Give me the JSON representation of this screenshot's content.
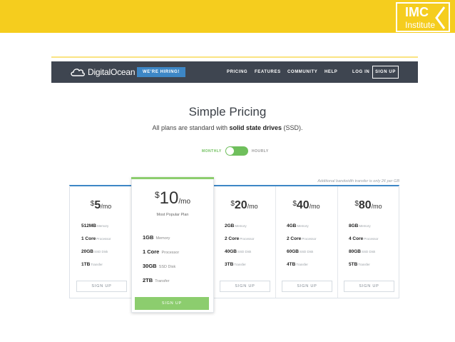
{
  "header_band": {
    "logo_main": "IMC",
    "logo_sub": "Institute",
    "color": "#f5cd1e"
  },
  "navbar": {
    "brand": "DigitalOcean",
    "hiring_badge": "WE'RE HIRING!",
    "items": [
      "PRICING",
      "FEATURES",
      "COMMUNITY",
      "HELP",
      "LOG IN"
    ],
    "signup": "SIGN UP"
  },
  "hero": {
    "title": "Simple Pricing",
    "subtitle_pre": "All plans are standard with ",
    "subtitle_bold": "solid state drives",
    "subtitle_post": " (SSD)."
  },
  "billing_toggle": {
    "monthly": "MONTHLY",
    "hourly": "HOURLY",
    "selected": "MONTHLY"
  },
  "note": "Additional bandwidth transfer is only 2¢ per GB",
  "plans": [
    {
      "currency": "$",
      "amount": "5",
      "period": "/mo",
      "specs": [
        {
          "value": "512MB",
          "unit": "Memory"
        },
        {
          "value": "1 Core",
          "unit": "Processor"
        },
        {
          "value": "20GB",
          "unit": "SSD Disk"
        },
        {
          "value": "1TB",
          "unit": "Transfer"
        }
      ],
      "cta": "SIGN UP"
    },
    {
      "currency": "$",
      "amount": "10",
      "period": "/mo",
      "tag": "Most Popular Plan",
      "specs": [
        {
          "value": "1GB",
          "unit": "Memory"
        },
        {
          "value": "1 Core",
          "unit": "Processor"
        },
        {
          "value": "30GB",
          "unit": "SSD Disk"
        },
        {
          "value": "2TB",
          "unit": "Transfer"
        }
      ],
      "cta": "SIGN UP"
    },
    {
      "currency": "$",
      "amount": "20",
      "period": "/mo",
      "specs": [
        {
          "value": "2GB",
          "unit": "Memory"
        },
        {
          "value": "2 Core",
          "unit": "Processor"
        },
        {
          "value": "40GB",
          "unit": "SSD Disk"
        },
        {
          "value": "3TB",
          "unit": "Transfer"
        }
      ],
      "cta": "SIGN UP"
    },
    {
      "currency": "$",
      "amount": "40",
      "period": "/mo",
      "specs": [
        {
          "value": "4GB",
          "unit": "Memory"
        },
        {
          "value": "2 Core",
          "unit": "Processor"
        },
        {
          "value": "60GB",
          "unit": "SSD Disk"
        },
        {
          "value": "4TB",
          "unit": "Transfer"
        }
      ],
      "cta": "SIGN UP"
    },
    {
      "currency": "$",
      "amount": "80",
      "period": "/mo",
      "specs": [
        {
          "value": "8GB",
          "unit": "Memory"
        },
        {
          "value": "4 Core",
          "unit": "Processor"
        },
        {
          "value": "80GB",
          "unit": "SSD Disk"
        },
        {
          "value": "5TB",
          "unit": "Transfer"
        }
      ],
      "cta": "SIGN UP"
    }
  ],
  "colors": {
    "navbar_bg": "#3e4550",
    "accent_blue": "#3d87c6",
    "accent_green": "#8ccd6e"
  }
}
